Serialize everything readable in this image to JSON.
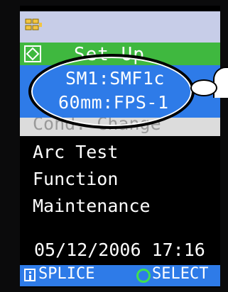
{
  "status_bar": {
    "battery_icon": "battery-icon"
  },
  "header": {
    "title": "Set Up",
    "icon": "diamond-square-icon"
  },
  "selection": {
    "line1": "SM1:SMF1c",
    "line2": "60mm:FPS-1"
  },
  "menu": {
    "cond_change": "Cond. Change",
    "items": [
      "Arc Test",
      "Function",
      "Maintenance"
    ]
  },
  "datetime": "05/12/2006 17:16",
  "bottom_bar": {
    "splice_label": "SPLICE",
    "select_label": "SELECT",
    "info_icon": "info-icon",
    "select_circle_icon": "circle-icon"
  },
  "colors": {
    "screen_bg": "#000000",
    "status_bar": "#c7cde8",
    "header_green": "#3fb83f",
    "highlight_blue": "#2e7be8",
    "text_white": "#ffffff"
  }
}
